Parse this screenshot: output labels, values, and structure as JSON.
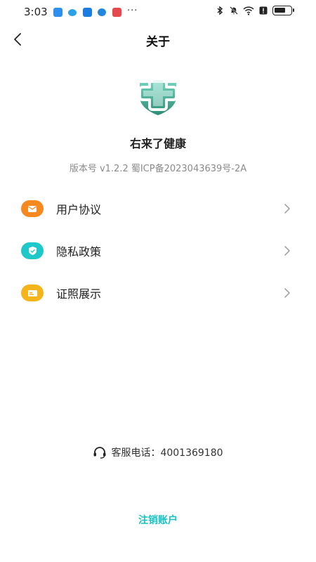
{
  "status_bar": {
    "time": "3:03",
    "more": "···",
    "battery_level": 0.7
  },
  "nav": {
    "title": "关于",
    "back_icon": "chevron-left-icon"
  },
  "app": {
    "name": "右来了健康",
    "version_line": "版本号 v1.2.2 蜀ICP备2023043639号-2A",
    "logo_icon": "medical-cross-shield-icon"
  },
  "menu": {
    "items": [
      {
        "label": "用户协议",
        "icon": "envelope-icon",
        "icon_color": "#f5891f"
      },
      {
        "label": "隐私政策",
        "icon": "shield-check-icon",
        "icon_color": "#1ec8c8"
      },
      {
        "label": "证照展示",
        "icon": "id-card-icon",
        "icon_color": "#f5b41a"
      }
    ]
  },
  "service": {
    "label": "客服电话：4001369180",
    "icon": "headset-icon"
  },
  "actions": {
    "cancel_account": "注销账户"
  },
  "colors": {
    "accent": "#16c2c2",
    "logo_green": "#3aa58c"
  }
}
